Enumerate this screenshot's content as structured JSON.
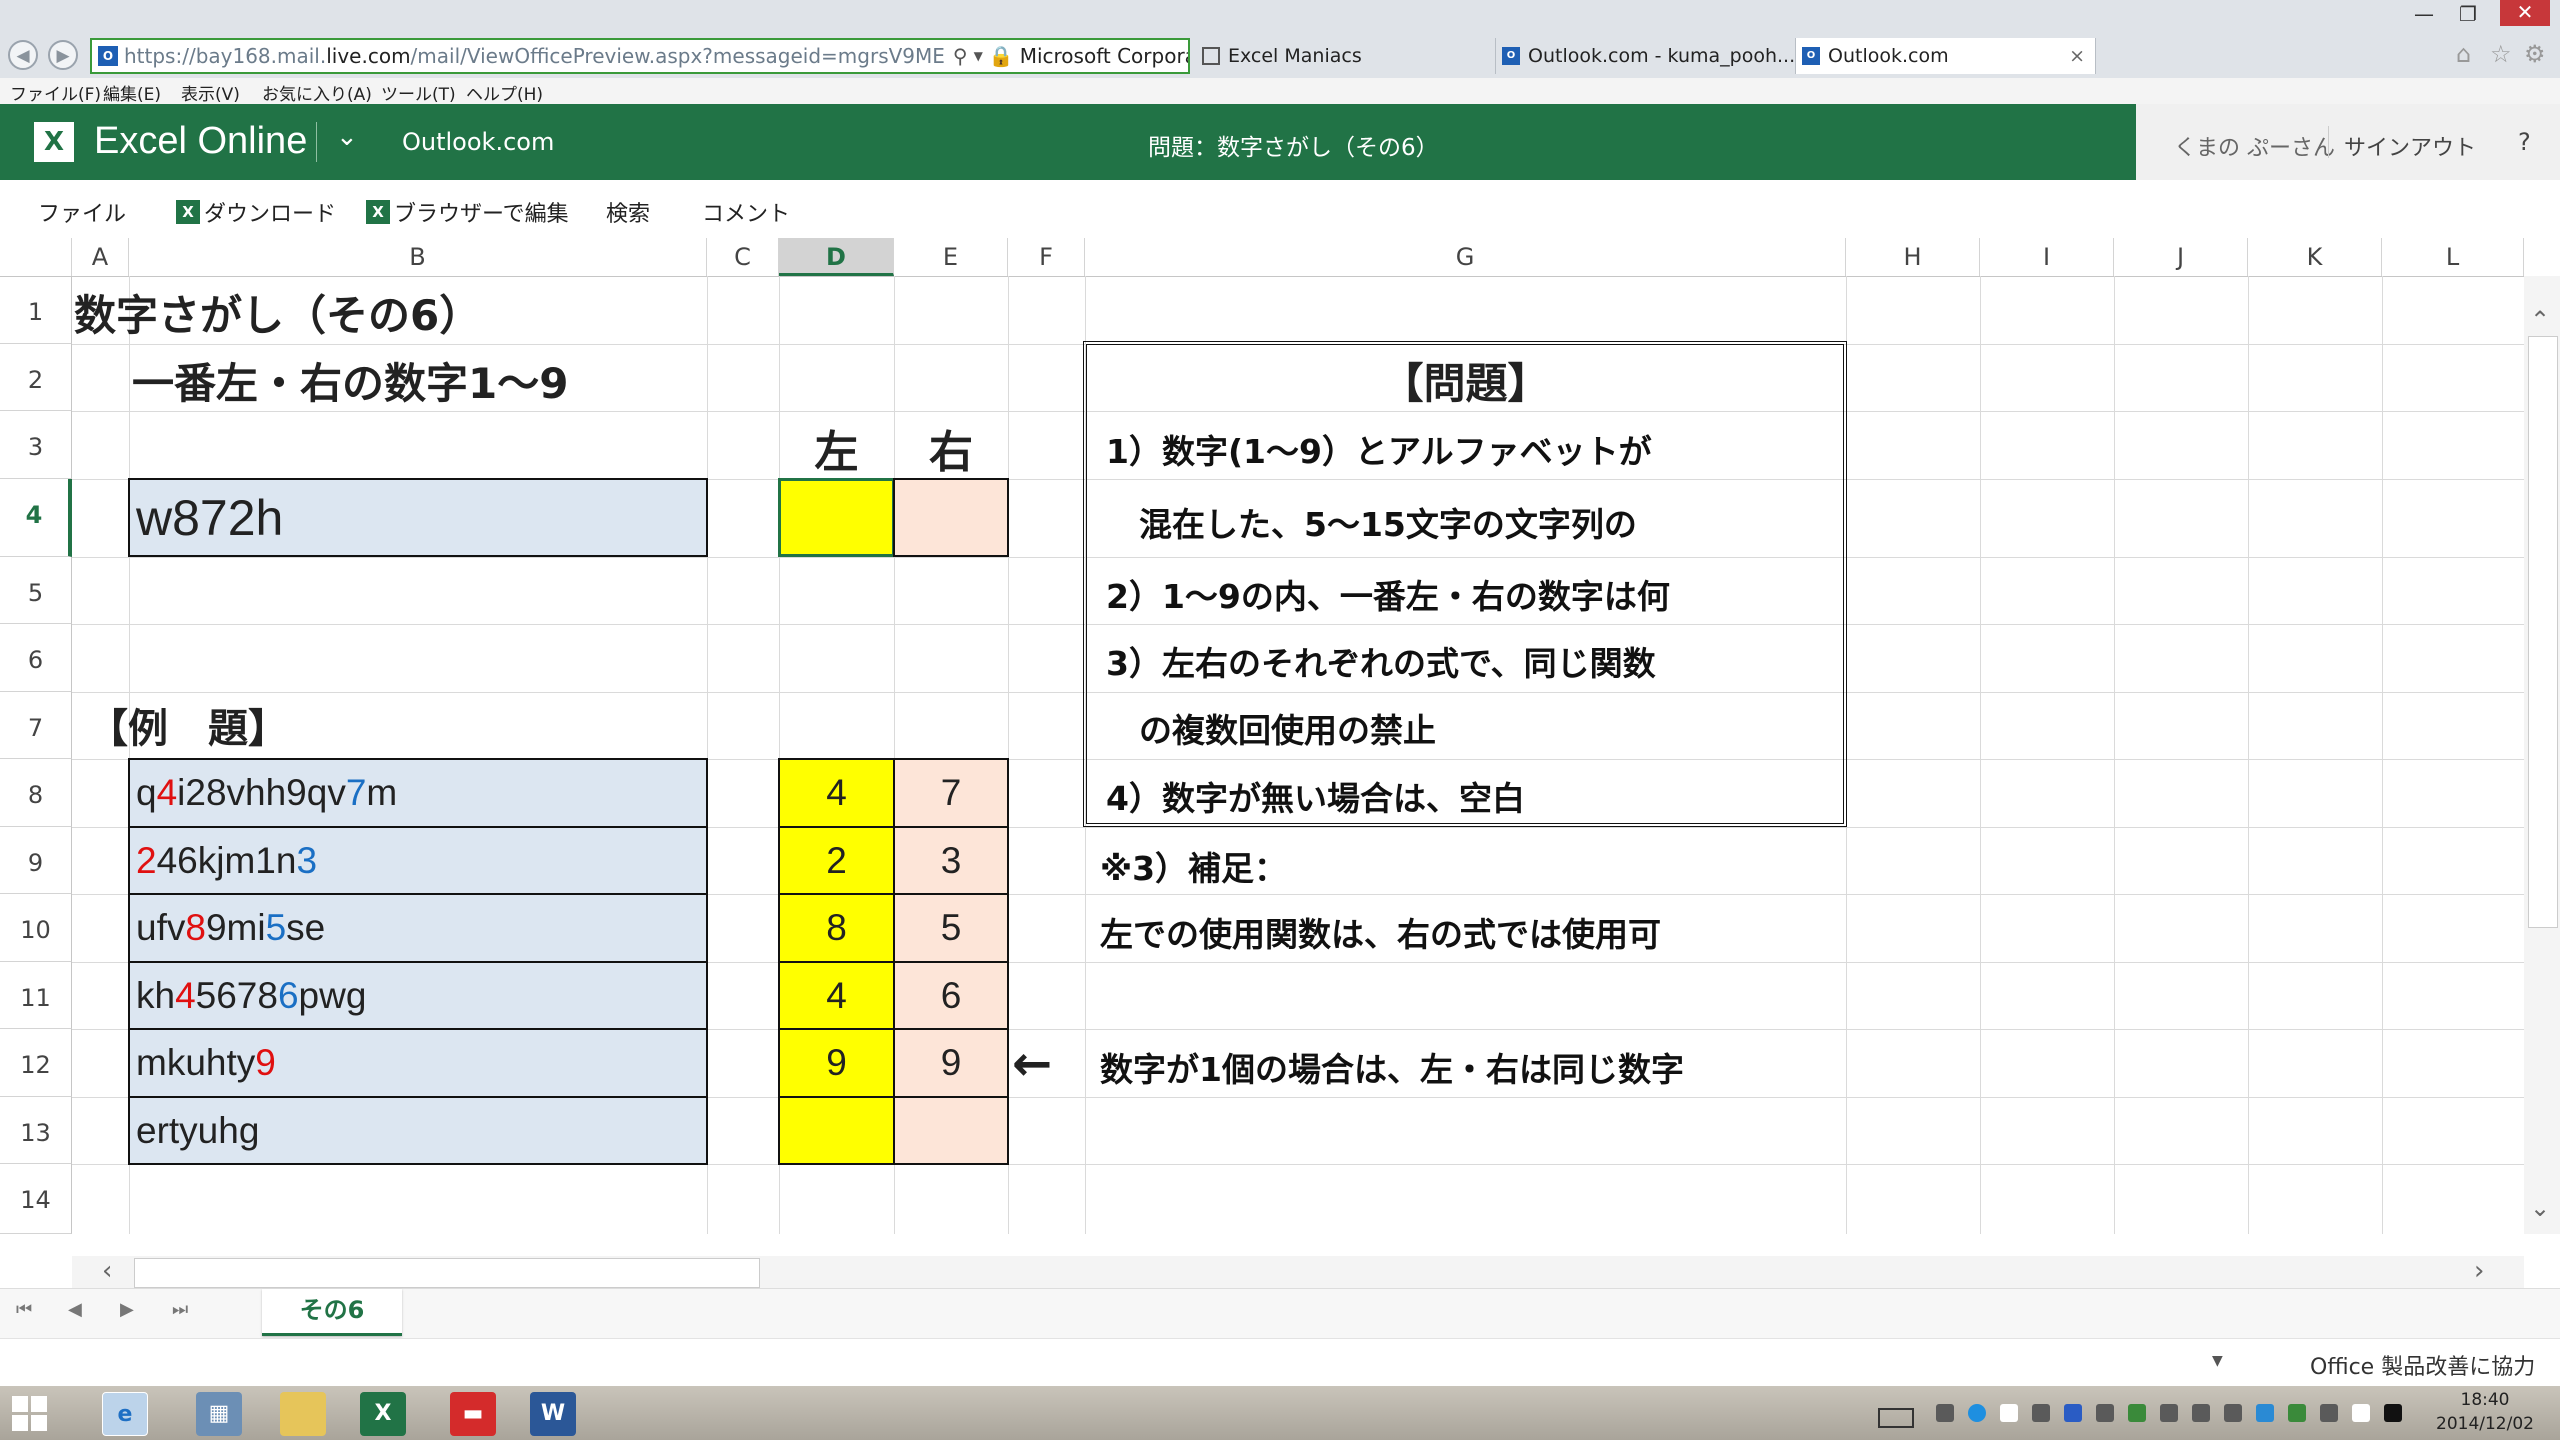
{
  "browser": {
    "url_prefix": "https://bay168.mail.",
    "url_domain": "live.com",
    "url_rest": "/mail/ViewOfficePreview.aspx?messageid=mgrsV9ME",
    "cert": "Microsoft Corporation [US]",
    "tabs": [
      {
        "label": "Excel Maniacs"
      },
      {
        "label": "Outlook.com - kuma_pooh..."
      },
      {
        "label": "Outlook.com"
      }
    ],
    "menu": [
      "ファイル(F)",
      "編集(E)",
      "表示(V)",
      "お気に入り(A)",
      "ツール(T)",
      "ヘルプ(H)"
    ]
  },
  "app": {
    "name": "Excel Online",
    "service": "Outlook.com",
    "doc_title": "問題：数字さがし（その6）",
    "user": "くまの ぷーさん",
    "signout": "サインアウト",
    "help": "?"
  },
  "toolbar": {
    "file": "ファイル",
    "download": "ダウンロード",
    "edit_browser": "ブラウザーで編集",
    "search": "検索",
    "comment": "コメント"
  },
  "columns": [
    "A",
    "B",
    "C",
    "D",
    "E",
    "F",
    "G",
    "H",
    "I",
    "J",
    "K",
    "L"
  ],
  "rows": [
    "1",
    "2",
    "3",
    "4",
    "5",
    "6",
    "7",
    "8",
    "9",
    "10",
    "11",
    "12",
    "13",
    "14"
  ],
  "sheet": {
    "title": "数字さがし（その6）",
    "subtitle": "一番左・右の数字1～9",
    "hdr_left": "左",
    "hdr_right": "右",
    "input": "w872h",
    "example_label": "【例　題】",
    "examples": [
      {
        "parts": [
          {
            "t": "q"
          },
          {
            "t": "4",
            "c": "red"
          },
          {
            "t": "i28vhh9qv"
          },
          {
            "t": "7",
            "c": "blu"
          },
          {
            "t": "m"
          }
        ],
        "left": "4",
        "right": "7"
      },
      {
        "parts": [
          {
            "t": "2",
            "c": "red"
          },
          {
            "t": "46kjm1n"
          },
          {
            "t": "3",
            "c": "blu"
          }
        ],
        "left": "2",
        "right": "3"
      },
      {
        "parts": [
          {
            "t": "ufv"
          },
          {
            "t": "8",
            "c": "red"
          },
          {
            "t": "9mi"
          },
          {
            "t": "5",
            "c": "blu"
          },
          {
            "t": "se"
          }
        ],
        "left": "8",
        "right": "5"
      },
      {
        "parts": [
          {
            "t": "kh"
          },
          {
            "t": "4",
            "c": "red"
          },
          {
            "t": "5678"
          },
          {
            "t": "6",
            "c": "blu"
          },
          {
            "t": "pwg"
          }
        ],
        "left": "4",
        "right": "6"
      },
      {
        "parts": [
          {
            "t": "mkuhty"
          },
          {
            "t": "9",
            "c": "red"
          }
        ],
        "left": "9",
        "right": "9"
      },
      {
        "parts": [
          {
            "t": "ertyuhg"
          }
        ],
        "left": "",
        "right": ""
      }
    ],
    "problem_title": "【問題】",
    "problem_lines": [
      "1）数字(1～9）とアルファベットが",
      "　混在した、5～15文字の文字列の",
      "2）1～9の内、一番左・右の数字は何",
      "3）左右のそれぞれの式で、同じ関数",
      "　の複数回使用の禁止",
      "4）数字が無い場合は、空白"
    ],
    "note_title": "※3）補足：",
    "note_text": "左での使用関数は、右の式では使用可",
    "arrow": "←",
    "arrow_note": "数字が1個の場合は、左・右は同じ数字"
  },
  "sheet_tab": "その6",
  "status": "Office 製品改善に協力",
  "clock": {
    "time": "18:40",
    "date": "2014/12/02"
  }
}
